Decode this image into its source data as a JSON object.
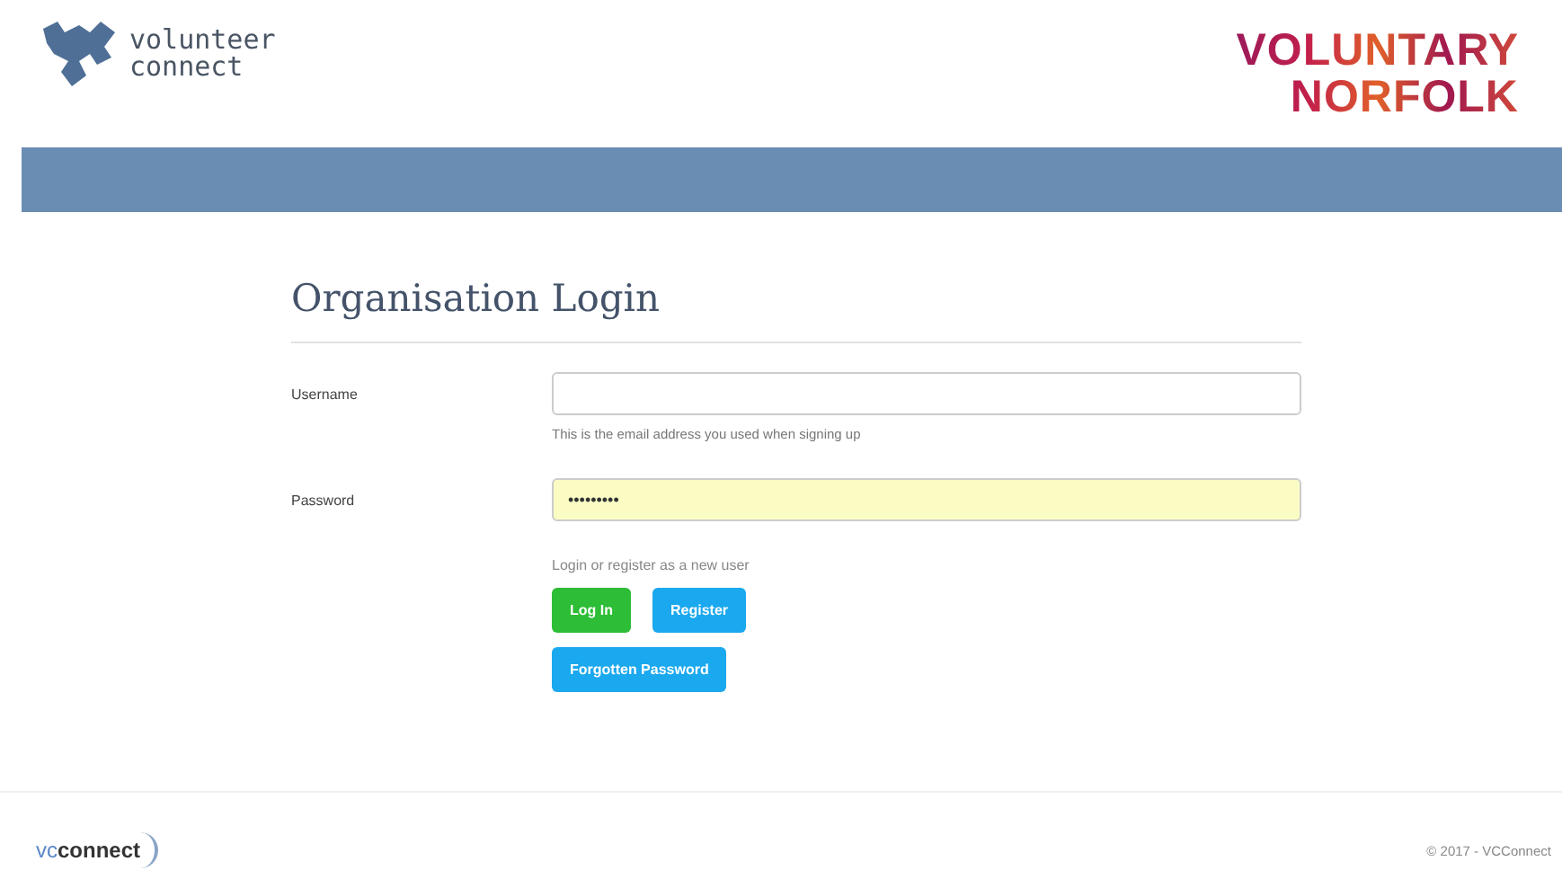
{
  "header": {
    "logo_lines": [
      "volunteer",
      "connect"
    ],
    "partner_logo_lines": [
      "VOLUNTARY",
      "NORFOLK"
    ]
  },
  "form": {
    "title": "Organisation Login",
    "fields": [
      {
        "label": "Username",
        "help": "This is the email address you used when signing up",
        "autofilled": false
      },
      {
        "label": "Password",
        "value": "•••••••••",
        "autofilled": true
      }
    ],
    "prompt": "Login or register as a new user",
    "buttons": [
      {
        "label": "Log In",
        "kind": "success"
      },
      {
        "label": "Register",
        "kind": "info"
      }
    ],
    "forgot_button": {
      "label": "Forgotten Password",
      "kind": "info"
    }
  },
  "footer": {
    "logo_prefix": "vc",
    "logo_name": "connect",
    "copyright": "© 2017 - VCConnect"
  }
}
